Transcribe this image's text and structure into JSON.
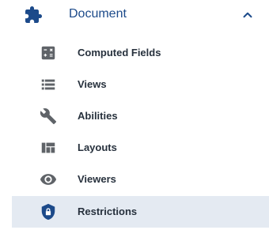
{
  "group": {
    "label": "Document",
    "icon": "puzzle-icon",
    "expanded": true,
    "chevron_icon": "chevron-up-icon"
  },
  "items": [
    {
      "label": "Computed Fields",
      "icon": "calculator-icon",
      "active": false
    },
    {
      "label": "Views",
      "icon": "list-icon",
      "active": false
    },
    {
      "label": "Abilities",
      "icon": "wrench-icon",
      "active": false
    },
    {
      "label": "Layouts",
      "icon": "layout-icon",
      "active": false
    },
    {
      "label": "Viewers",
      "icon": "eye-icon",
      "active": false
    },
    {
      "label": "Restrictions",
      "icon": "shield-lock-icon",
      "active": true
    }
  ],
  "colors": {
    "group_text": "#1c4a8a",
    "icon_gray": "#5f6368",
    "active_bg": "#e4eaf2",
    "active_icon": "#1c4a8a",
    "item_text": "#27313d"
  }
}
